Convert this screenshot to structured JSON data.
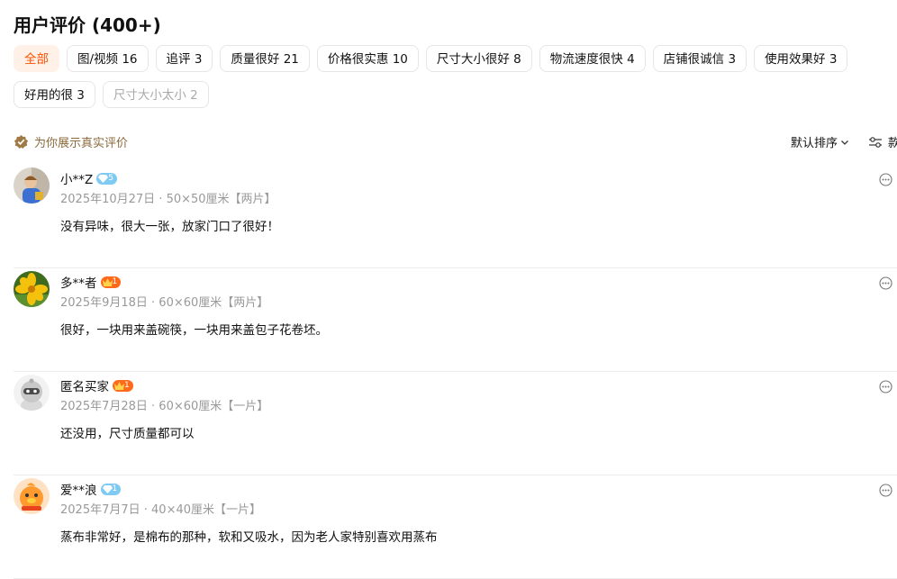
{
  "header": {
    "title": "用户评价 (400+)"
  },
  "tags": [
    {
      "label": "全部",
      "state": "active"
    },
    {
      "label": "图/视频 16",
      "state": "normal"
    },
    {
      "label": "追评 3",
      "state": "normal"
    },
    {
      "label": "质量很好 21",
      "state": "normal"
    },
    {
      "label": "价格很实惠 10",
      "state": "normal"
    },
    {
      "label": "尺寸大小很好 8",
      "state": "normal"
    },
    {
      "label": "物流速度很快 4",
      "state": "normal"
    },
    {
      "label": "店铺很诚信 3",
      "state": "normal"
    },
    {
      "label": "使用效果好 3",
      "state": "normal"
    },
    {
      "label": "好用的很 3",
      "state": "normal"
    },
    {
      "label": "尺寸大小太小 2",
      "state": "dim"
    }
  ],
  "notice": {
    "text": "为你展示真实评价",
    "icon": "verified-check-icon"
  },
  "sort": {
    "label": "默认排序",
    "icon": "chevron-down-icon"
  },
  "filter": {
    "label": "款",
    "icon": "filter-sliders-icon"
  },
  "colors": {
    "accent": "#ff5000",
    "accent_bg": "#fff0e8",
    "notice": "#8b6a3c",
    "meta": "#999999"
  },
  "reviews": [
    {
      "name": "小**Z",
      "badge": "5",
      "badge_type": "diamond-blue",
      "meta": "2025年10月27日 · 50×50厘米【两片】",
      "text": "没有异味，很大一张，放家门口了很好！",
      "avatar": "child-photo-avatar"
    },
    {
      "name": "多**者",
      "badge": "1",
      "badge_type": "crown-orange",
      "meta": "2025年9月18日 · 60×60厘米【两片】",
      "text": "很好，一块用来盖碗筷，一块用来盖包子花卷坯。",
      "avatar": "yellow-flower-avatar"
    },
    {
      "name": "匿名买家",
      "badge": "1",
      "badge_type": "crown-orange",
      "meta": "2025年7月28日 · 60×60厘米【一片】",
      "text": "还没用，尺寸质量都可以",
      "avatar": "anonymous-mascot-avatar"
    },
    {
      "name": "爱**浪",
      "badge": "1",
      "badge_type": "diamond-blue",
      "meta": "2025年7月7日 · 40×40厘米【一片】",
      "text": "蒸布非常好，是棉布的那种，软和又吸水，因为老人家特别喜欢用蒸布",
      "avatar": "orange-duck-avatar"
    }
  ]
}
